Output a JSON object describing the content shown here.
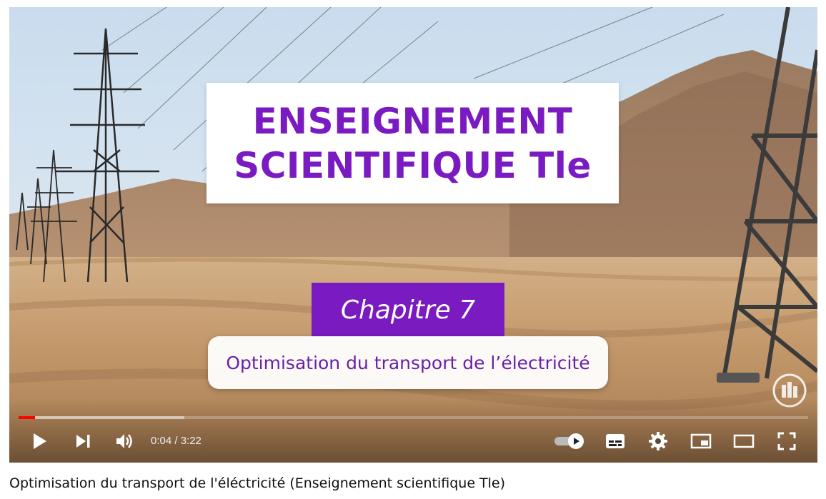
{
  "video": {
    "overlay": {
      "title_line_1": "ENSEIGNEMENT",
      "title_line_2": "SCIENTIFIQUE Tle",
      "chapter": "Chapitre 7",
      "subtitle": "Optimisation du transport de l’électricité"
    },
    "colors": {
      "accent_purple": "#7a1bc2",
      "progress_played": "#ff0000"
    },
    "progress": {
      "played_fraction": 0.0207,
      "buffered_fraction": 0.21
    },
    "controls": {
      "time_display": "0:04 / 3:22",
      "icons": [
        "play-icon",
        "next-icon",
        "volume-icon",
        "autoplay-toggle-icon",
        "subtitles-icon",
        "settings-gear-icon",
        "miniplayer-icon",
        "theater-mode-icon",
        "fullscreen-icon"
      ]
    }
  },
  "page": {
    "video_title": "Optimisation du transport de l'éléctricité (Enseignement scientifique Tle)"
  }
}
